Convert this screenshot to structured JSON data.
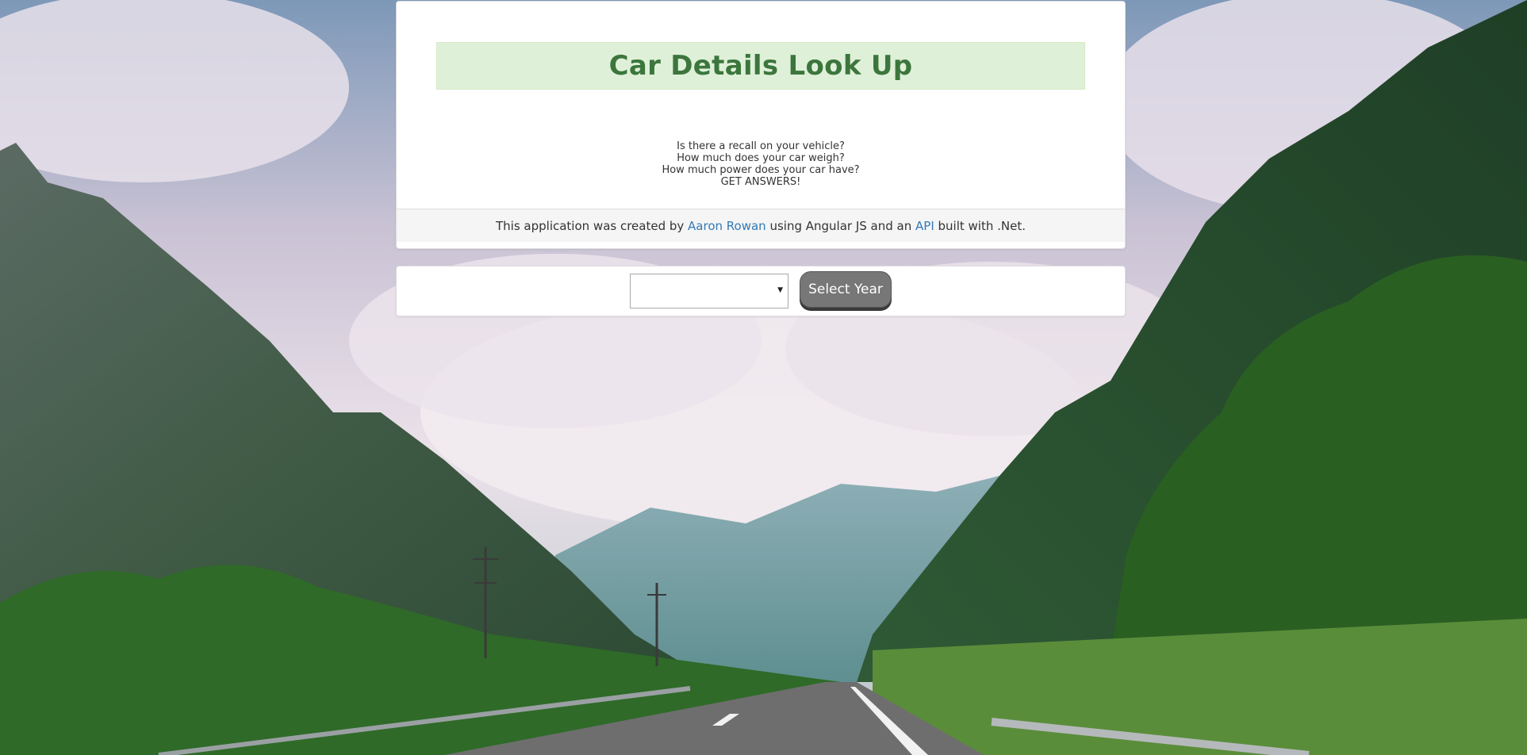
{
  "background": {
    "name": "mountain-valley-road-photo",
    "sky_color": "#c9c2d4",
    "cloud_color": "#ede6ee",
    "mountain_color": "#3f5a45",
    "forest_color": "#2f6a28",
    "road_color": "#6e6e6e"
  },
  "header": {
    "title": "Car Details Look Up",
    "title_color": "#3c763d",
    "banner_color": "#dff0d8"
  },
  "intro": {
    "questions": [
      "Is there a recall on your vehicle?",
      "How much does your car weigh?",
      "How much power does your car have?",
      "GET ANSWERS!"
    ]
  },
  "footer": {
    "text_before": "This application was created by ",
    "author_link": "Aaron Rowan",
    "text_middle": " using Angular JS and an ",
    "api_link": "API",
    "text_after": " built with .Net.",
    "link_color": "#337ab7"
  },
  "year_selector": {
    "selected_value": "",
    "arrow_icon": "dropdown-triangle",
    "button_label": "Select Year"
  }
}
